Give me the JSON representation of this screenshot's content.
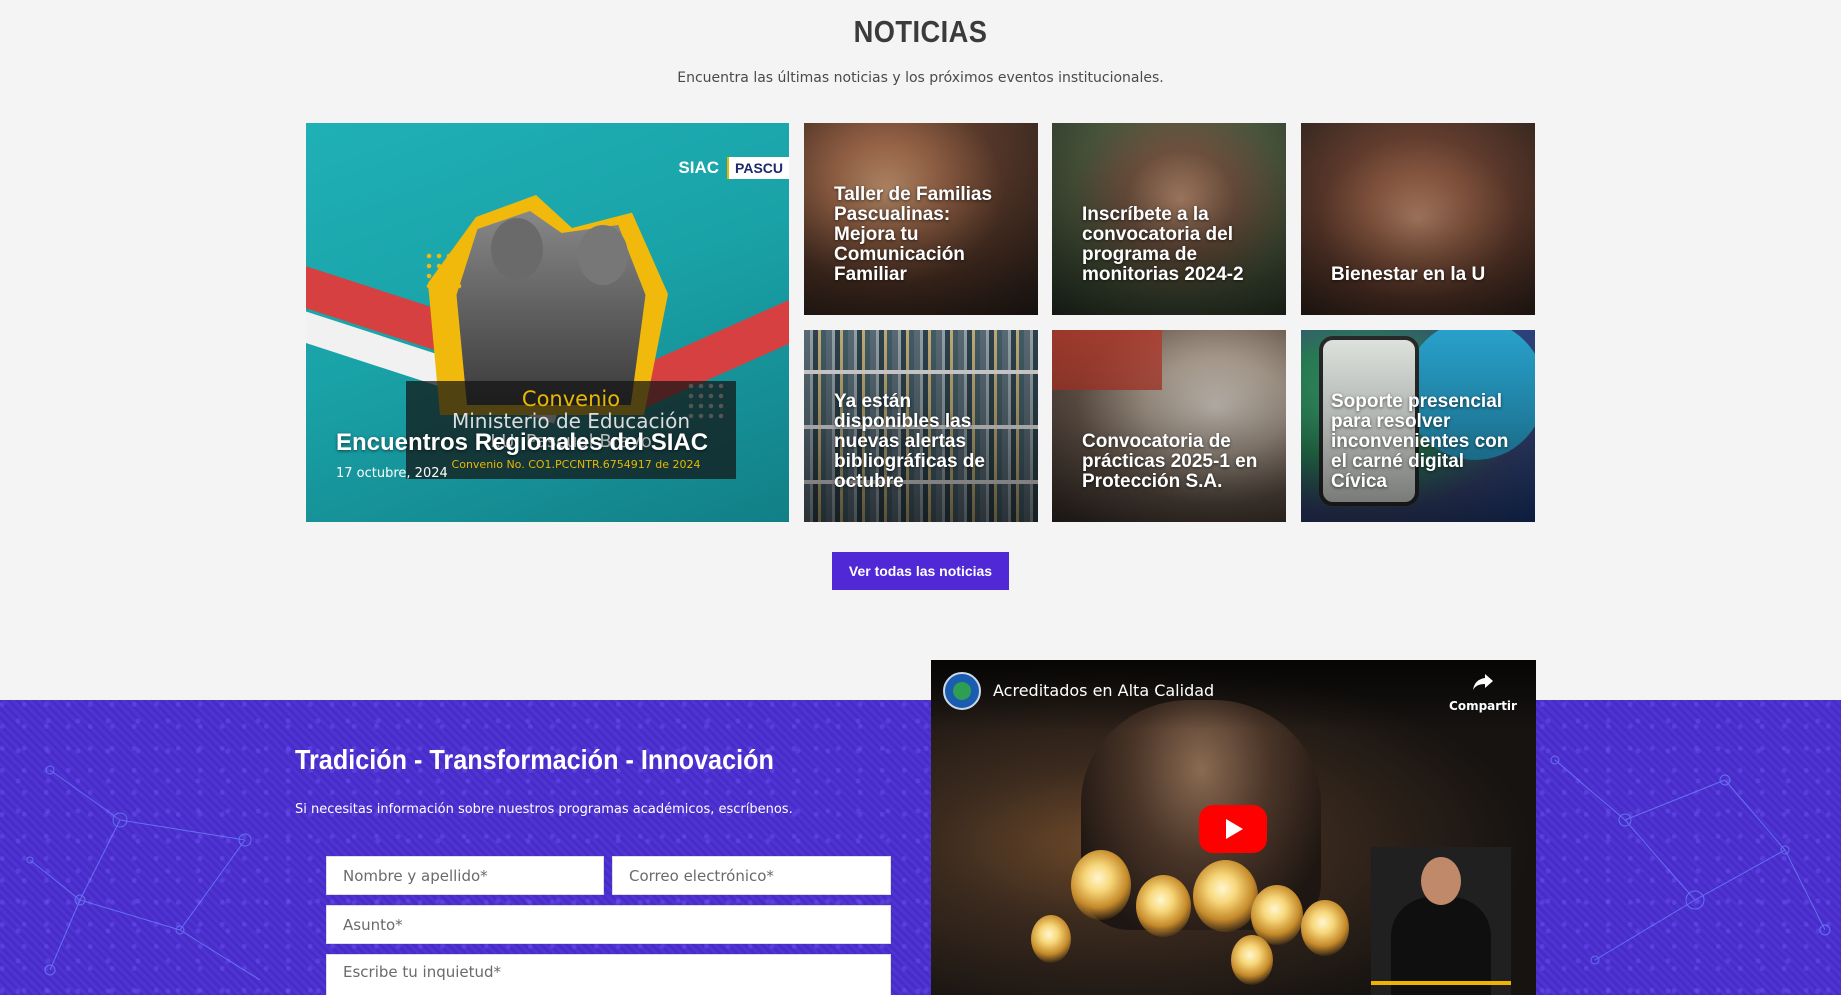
{
  "news": {
    "title": "NOTICIAS",
    "subtitle": "Encuentra las últimas noticias y los próximos eventos institucionales.",
    "featured": {
      "title": "Encuentros Regionales del SIAC",
      "date": "17 octubre, 2024",
      "image_text": {
        "logo_left": "SIAC",
        "logo_right": "PASCU",
        "line1": "Convenio",
        "line2": "Ministerio de Educación",
        "line3": "I.U. Pascual Bravo",
        "line4": "Convenio No. CO1.PCCNTR.6754917 de 2024"
      }
    },
    "items": [
      {
        "title": "Taller de Familias Pascualinas: Mejora tu Comunicación Familiar"
      },
      {
        "title": "Inscríbete a la convocatoria del programa de monitorias 2024-2"
      },
      {
        "title": "Bienestar en la U"
      },
      {
        "title": "Ya están disponibles las nuevas alertas bibliográficas de octubre"
      },
      {
        "title": "Convocatoria de prácticas 2025-1 en Protección S.A."
      },
      {
        "title": "Soporte presencial para resolver inconvenientes con el carné digital Cívica"
      }
    ],
    "view_all_label": "Ver todas las noticias"
  },
  "contact": {
    "title": "Tradición - Transformación - Innovación",
    "subtitle": "Si necesitas información sobre nuestros programas académicos, escríbenos.",
    "fields": {
      "name_placeholder": "Nombre y apellido*",
      "email_placeholder": "Correo electrónico*",
      "subject_placeholder": "Asunto*",
      "message_placeholder": "Escribe tu inquietud*"
    }
  },
  "video": {
    "title": "Acreditados en Alta Calidad",
    "share_label": "Compartir",
    "share_icon": "share-arrow-icon",
    "play_icon": "youtube-play-icon"
  },
  "colors": {
    "accent_purple": "#5028d6",
    "contact_bg": "#4a2dd0",
    "youtube_red": "#ff0000",
    "heading_gray": "#3b3b3b"
  }
}
